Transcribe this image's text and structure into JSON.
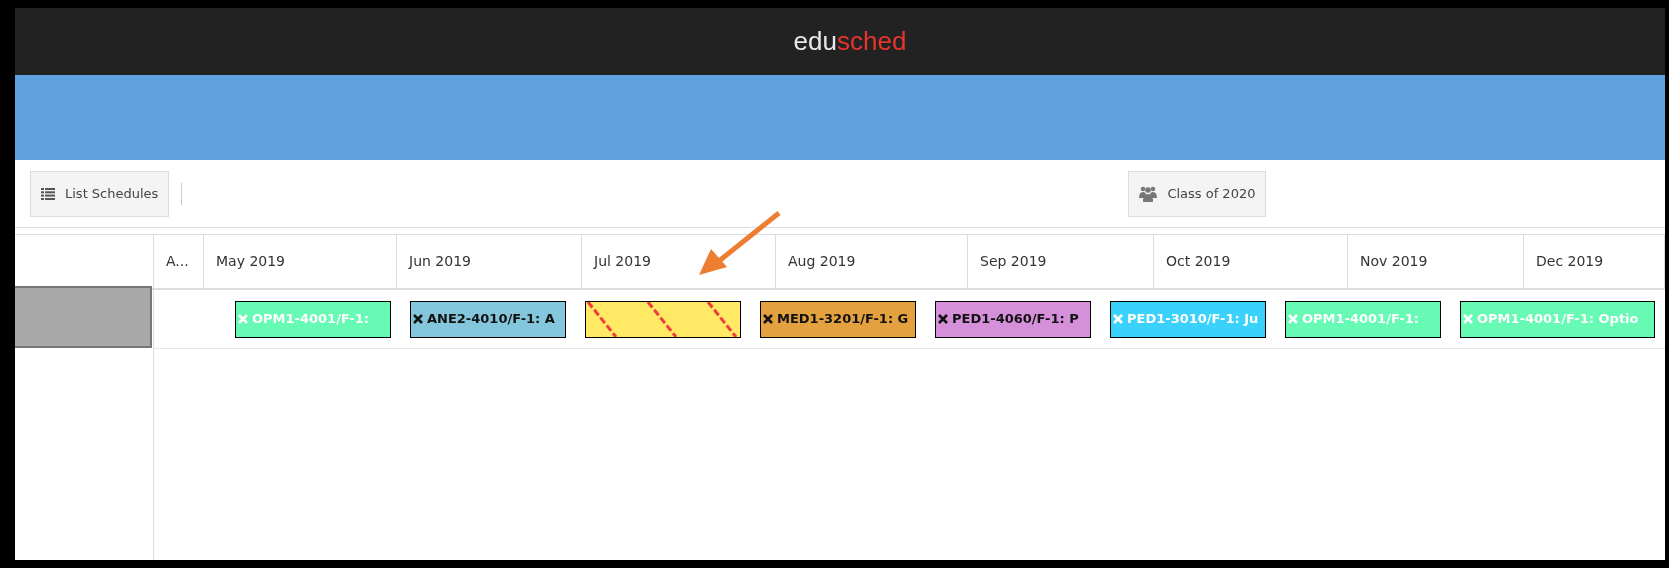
{
  "app": {
    "logo_first": "edu",
    "logo_second": "sched"
  },
  "toolbar": {
    "list_button": "List Schedules",
    "class_button": "Class of 2020"
  },
  "timeline": {
    "columns": [
      "A...",
      "May 2019",
      "Jun 2019",
      "Jul 2019",
      "Aug 2019",
      "Sep 2019",
      "Oct 2019",
      "Nov 2019",
      "Dec 2019"
    ],
    "row": {
      "selected": true
    },
    "events": [
      {
        "kind": "block",
        "label": "OPM1-4001/F-1:",
        "color": "#66fab5",
        "light_text": true
      },
      {
        "kind": "block",
        "label": "ANE2-4010/F-1: A",
        "color": "#84c7dc",
        "light_text": false
      },
      {
        "kind": "striped",
        "color": "#ffe965"
      },
      {
        "kind": "block",
        "label": "MED1-3201/F-1: G",
        "color": "#e4a13f",
        "light_text": false
      },
      {
        "kind": "block",
        "label": "PED1-4060/F-1: P",
        "color": "#d68fd9",
        "light_text": false
      },
      {
        "kind": "block",
        "label": "PED1-3010/F-1: Ju",
        "color": "#3ad2fa",
        "light_text": true
      },
      {
        "kind": "block",
        "label": "OPM1-4001/F-1:",
        "color": "#66fab5",
        "light_text": true
      },
      {
        "kind": "block",
        "label": "OPM1-4001/F-1: Optio",
        "color": "#66fab5",
        "light_text": true
      }
    ]
  }
}
